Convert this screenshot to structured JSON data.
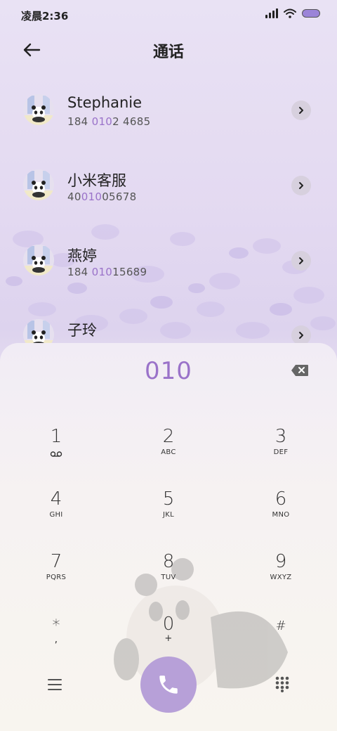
{
  "status_bar": {
    "time": "凌晨2:36",
    "battery_color": "#9b84d8"
  },
  "header": {
    "title": "通话",
    "back_icon": "arrow-left-icon"
  },
  "contacts": [
    {
      "name": "Stephanie",
      "number_pre": "184 ",
      "number_match": "010",
      "number_post": "2 4685"
    },
    {
      "name": "小米客服",
      "number_pre": "40",
      "number_match": "010",
      "number_post": "05678"
    },
    {
      "name": "燕婷",
      "number_pre": "184 ",
      "number_match": "010",
      "number_post": "15689"
    },
    {
      "name": "子玲",
      "number_pre": "",
      "number_match": "",
      "number_post": ""
    }
  ],
  "dialer": {
    "entered": "010",
    "accent_color": "#9a72c9",
    "call_button_color": "#b7a0d8",
    "keys": [
      {
        "num": "1",
        "letters": ""
      },
      {
        "num": "2",
        "letters": "ABC"
      },
      {
        "num": "3",
        "letters": "DEF"
      },
      {
        "num": "4",
        "letters": "GHI"
      },
      {
        "num": "5",
        "letters": "JKL"
      },
      {
        "num": "6",
        "letters": "MNO"
      },
      {
        "num": "7",
        "letters": "PQRS"
      },
      {
        "num": "8",
        "letters": "TUV"
      },
      {
        "num": "9",
        "letters": "WXYZ"
      },
      {
        "num": "*",
        "letters": ","
      },
      {
        "num": "0",
        "letters": "+"
      },
      {
        "num": "#",
        "letters": ""
      }
    ]
  }
}
